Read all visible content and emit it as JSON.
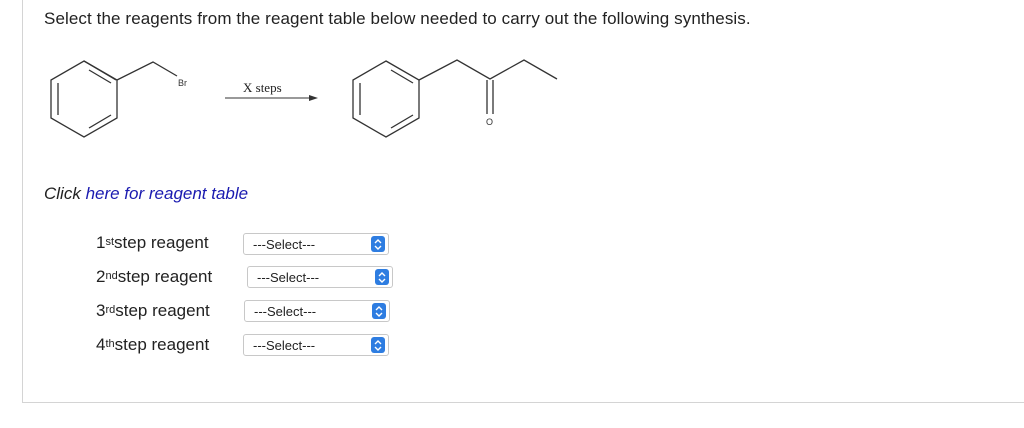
{
  "question": {
    "prompt": "Select the reagents from the reagent table below needed to carry out the following synthesis."
  },
  "scheme": {
    "reactant_atom_label": "Br",
    "arrow_label": "X steps",
    "product_atom_label": "O"
  },
  "reagent_table_link": {
    "prefix": "Click ",
    "link_text": "here for reagent table"
  },
  "steps": [
    {
      "ordinal": "1",
      "suffix": "st",
      "label": " step reagent",
      "selected": "---Select---"
    },
    {
      "ordinal": "2",
      "suffix": "nd",
      "label": " step reagent",
      "selected": "---Select---"
    },
    {
      "ordinal": "3",
      "suffix": "rd",
      "label": " step reagent",
      "selected": "---Select---"
    },
    {
      "ordinal": "4",
      "suffix": "th",
      "label": " step reagent",
      "selected": "---Select---"
    }
  ],
  "colors": {
    "link": "#1a1ab0",
    "select_arrow": "#2e7de1"
  },
  "icons": {
    "select_arrow": "up-down-chevron-icon"
  }
}
